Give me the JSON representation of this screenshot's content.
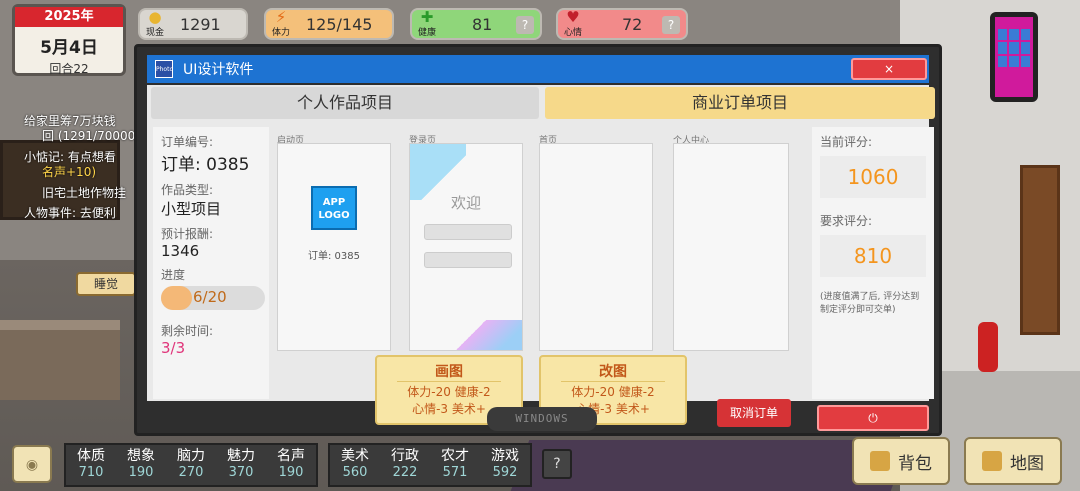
{
  "hud": {
    "year": "2025年",
    "date": "5月4日",
    "turn": "回合22",
    "cash": {
      "label": "现金",
      "value": "1291"
    },
    "stamina": {
      "label": "体力",
      "value": "125/145"
    },
    "health": {
      "label": "健康",
      "value": "81"
    },
    "mood": {
      "label": "心情",
      "value": "72"
    },
    "help": "?"
  },
  "tasks": [
    {
      "text": "给家里筹7万块钱"
    },
    {
      "text": "回 (1291/70000"
    },
    {
      "text": "小惦记: 有点想看"
    },
    {
      "text": "名声+10)"
    },
    {
      "text": "旧宅土地作物挂"
    },
    {
      "text": "人物事件: 去便利"
    }
  ],
  "sleep_label": "睡觉",
  "window": {
    "app_icon": "Photo",
    "title": "UI设计软件",
    "close": "×",
    "tabs": {
      "personal": "个人作品项目",
      "business": "商业订单项目"
    },
    "order": {
      "id_label": "订单编号:",
      "id_value": "订单: 0385",
      "type_label": "作品类型:",
      "type_value": "小型项目",
      "reward_label": "预计报酬:",
      "reward_value": "1346",
      "progress_label": "进度",
      "progress_value": "6/20",
      "progress_fraction": 0.3,
      "remaining_label": "剩余时间:",
      "remaining_value": "3/3"
    },
    "pages": {
      "splash": {
        "label": "启动页",
        "logo": "APP LOGO",
        "caption": "订单: 0385"
      },
      "login": {
        "label": "登录页",
        "welcome": "欢迎"
      },
      "home": {
        "label": "首页"
      },
      "profile": {
        "label": "个人中心"
      }
    },
    "actions": {
      "draw": {
        "title": "画图",
        "line1": "体力-20 健康-2",
        "line2": "心情-3 美术+"
      },
      "revise": {
        "title": "改图",
        "line1": "体力-20 健康-2",
        "line2": "心情-3 美术+"
      }
    },
    "cancel_order": "取消订单",
    "score": {
      "current_label": "当前评分:",
      "current_value": "1060",
      "required_label": "要求评分:",
      "required_value": "810",
      "note": "(进度值满了后, 评分达到制定评分即可交单)"
    },
    "windows_label": "WINDOWS",
    "power": "⏻"
  },
  "attributes": {
    "group1": [
      {
        "name": "体质",
        "value": "710"
      },
      {
        "name": "想象",
        "value": "190"
      },
      {
        "name": "脑力",
        "value": "270"
      },
      {
        "name": "魅力",
        "value": "370"
      },
      {
        "name": "名声",
        "value": "190"
      }
    ],
    "group2": [
      {
        "name": "美术",
        "value": "560"
      },
      {
        "name": "行政",
        "value": "222"
      },
      {
        "name": "农才",
        "value": "571"
      },
      {
        "name": "游戏",
        "value": "592"
      }
    ]
  },
  "bottom": {
    "help": "?",
    "backpack": "背包",
    "map": "地图"
  },
  "colors": {
    "accent_blue": "#1e73d2",
    "danger_red": "#e23c40",
    "tab_gold": "#f6d98a",
    "score_orange": "#f4951e"
  }
}
